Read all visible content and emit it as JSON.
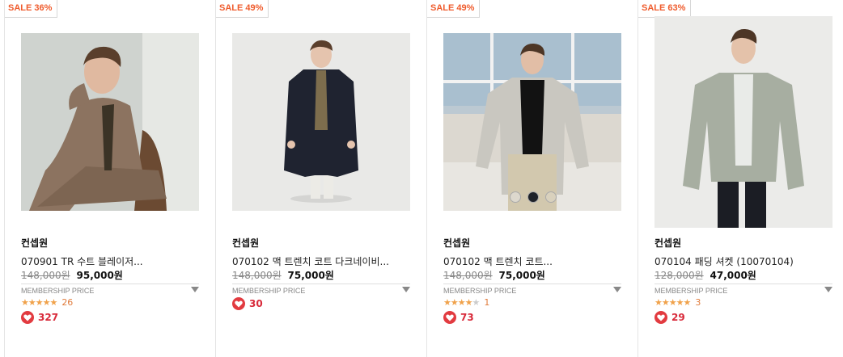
{
  "products": [
    {
      "badge": "SALE 36%",
      "brand": "컨셉원",
      "name": "070901 TR 수트 블레이저...",
      "original_price": "148,000원",
      "sale_price": "95,000원",
      "membership_label": "MEMBERSHIP PRICE",
      "rating_stars": 5,
      "review_count": "26",
      "likes": "327"
    },
    {
      "badge": "SALE 49%",
      "brand": "컨셉원",
      "name": "070102 맥 트렌치 코트 다크네이비...",
      "original_price": "148,000원",
      "sale_price": "75,000원",
      "membership_label": "MEMBERSHIP PRICE",
      "rating_stars": 0,
      "review_count": "",
      "likes": "30"
    },
    {
      "badge": "SALE 49%",
      "brand": "컨셉원",
      "name": "070102 맥 트렌치 코트...",
      "original_price": "148,000원",
      "sale_price": "75,000원",
      "membership_label": "MEMBERSHIP PRICE",
      "rating_stars": 4,
      "review_count": "1",
      "likes": "73",
      "swatches": [
        "#ddd8cd",
        "#1e2229",
        "#d9d1bd"
      ]
    },
    {
      "badge": "SALE 63%",
      "brand": "컨셉원",
      "name": "070104 패딩 셔켓 (10070104)",
      "original_price": "128,000원",
      "sale_price": "47,000원",
      "membership_label": "MEMBERSHIP PRICE",
      "rating_stars": 5,
      "review_count": "3",
      "likes": "29"
    }
  ],
  "colors": {
    "accent": "#ef5b2c",
    "heart": "#e23b40",
    "star": "#f0a24b"
  },
  "icons": {
    "star": "star-icon",
    "heart": "heart-icon",
    "dropdown": "dropdown-triangle-icon"
  }
}
